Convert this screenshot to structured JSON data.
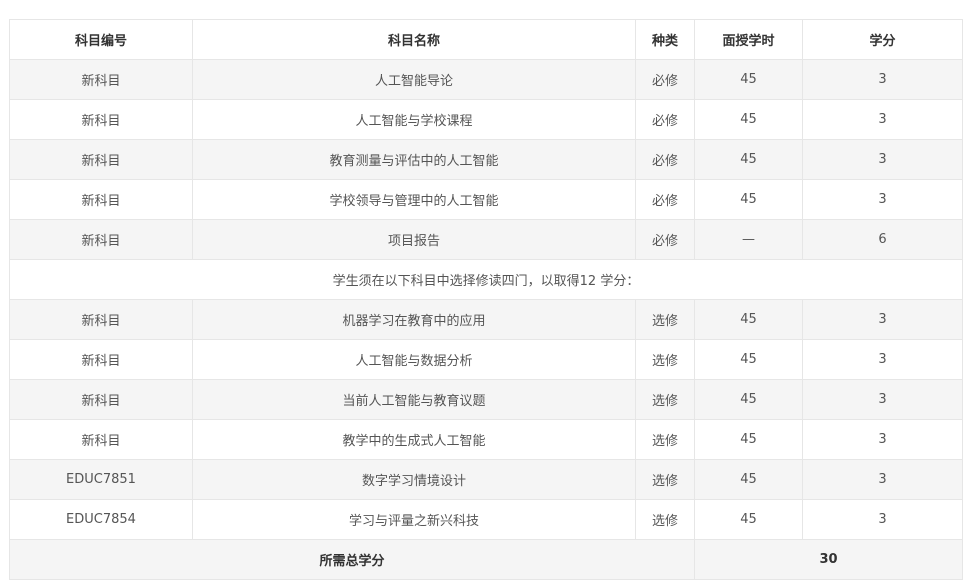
{
  "header": {
    "code": "科目编号",
    "name": "科目名称",
    "type": "种类",
    "hours": "面授学时",
    "credits": "学分"
  },
  "required_rows": [
    {
      "code": "新科目",
      "name": "人工智能导论",
      "type": "必修",
      "hours": "45",
      "credits": "3"
    },
    {
      "code": "新科目",
      "name": "人工智能与学校课程",
      "type": "必修",
      "hours": "45",
      "credits": "3"
    },
    {
      "code": "新科目",
      "name": "教育测量与评估中的人工智能",
      "type": "必修",
      "hours": "45",
      "credits": "3"
    },
    {
      "code": "新科目",
      "name": "学校领导与管理中的人工智能",
      "type": "必修",
      "hours": "45",
      "credits": "3"
    },
    {
      "code": "新科目",
      "name": "项目报告",
      "type": "必修",
      "hours": "—",
      "credits": "6"
    }
  ],
  "elective_note": "学生须在以下科目中选择修读四门，以取得12 学分：",
  "elective_rows": [
    {
      "code": "新科目",
      "name": "机器学习在教育中的应用",
      "type": "选修",
      "hours": "45",
      "credits": "3"
    },
    {
      "code": "新科目",
      "name": "人工智能与数据分析",
      "type": "选修",
      "hours": "45",
      "credits": "3"
    },
    {
      "code": "新科目",
      "name": "当前人工智能与教育议题",
      "type": "选修",
      "hours": "45",
      "credits": "3"
    },
    {
      "code": "新科目",
      "name": "教学中的生成式人工智能",
      "type": "选修",
      "hours": "45",
      "credits": "3"
    },
    {
      "code": "EDUC7851",
      "name": "数字学习情境设计",
      "type": "选修",
      "hours": "45",
      "credits": "3"
    },
    {
      "code": "EDUC7854",
      "name": "学习与评量之新兴科技",
      "type": "选修",
      "hours": "45",
      "credits": "3"
    }
  ],
  "total": {
    "label": "所需总学分",
    "value": "30"
  }
}
